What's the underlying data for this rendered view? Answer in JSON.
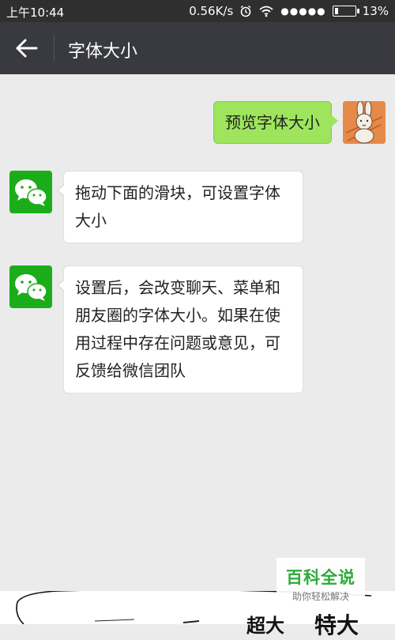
{
  "status_bar": {
    "time": "上午10:44",
    "network_speed": "0.56K/s",
    "battery": "13%"
  },
  "header": {
    "title": "字体大小"
  },
  "messages": {
    "preview": "预览字体大小",
    "msg1": "拖动下面的滑块，可设置字体大小",
    "msg2": "设置后，会改变聊天、菜单和朋友圈的字体大小。如果在使用过程中存在问题或意见，可反馈给微信团队"
  },
  "slider": {
    "label_large": "超大",
    "label_extra": "特大"
  },
  "watermark": {
    "title": "百科全说",
    "subtitle": "助你轻松解决"
  }
}
